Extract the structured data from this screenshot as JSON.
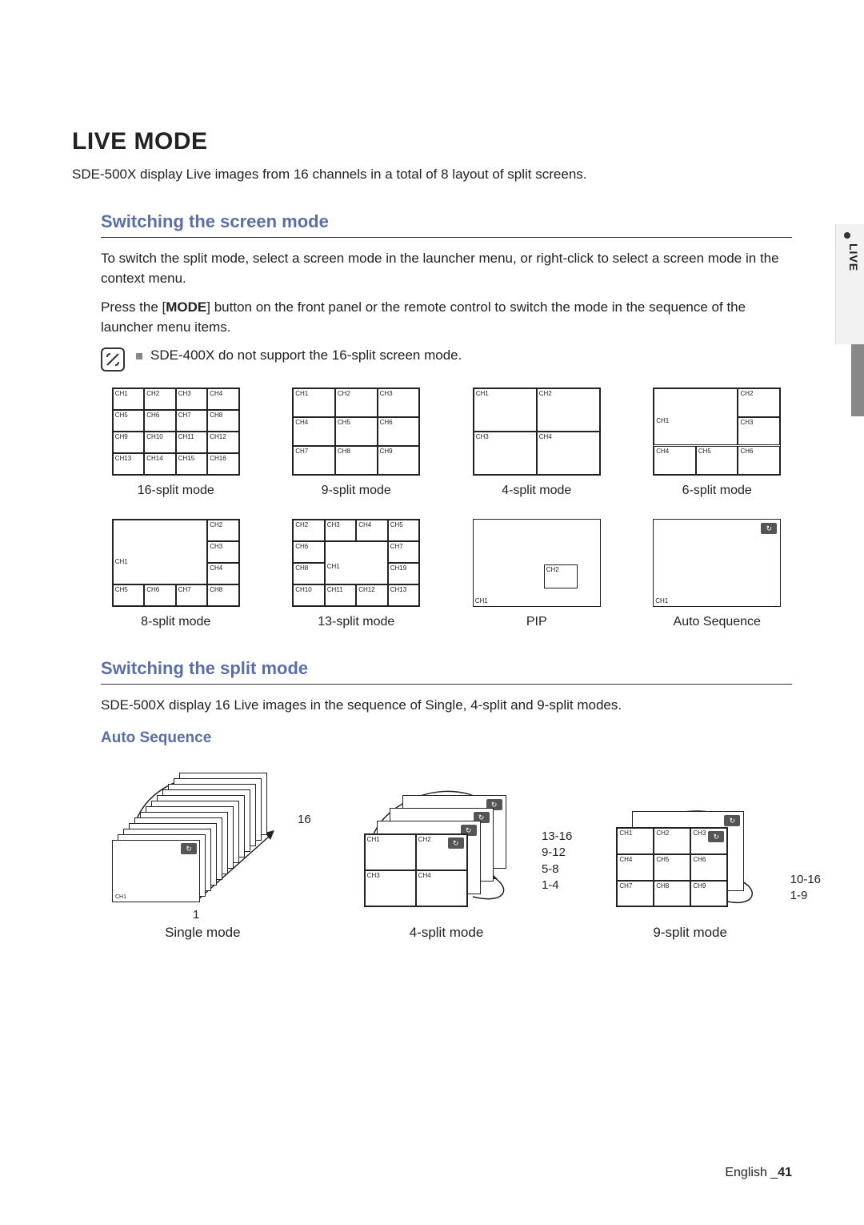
{
  "sideTab": "LIVE",
  "heading": "LIVE MODE",
  "intro": "SDE-500X display Live images from 16 channels in a total of 8 layout of split screens.",
  "section1": {
    "title": "Switching the screen mode",
    "para1": "To switch the split mode, select a screen mode in the launcher menu, or right-click to select a screen mode in the context menu.",
    "para2a": "Press the [",
    "para2bold": "MODE",
    "para2b": "] button on the front panel or the remote control to switch the mode in the sequence of the launcher menu items.",
    "note": "SDE-400X do not support the 16-split screen mode."
  },
  "diagRow1": {
    "d16": {
      "label": "16-split mode",
      "cells": [
        "CH1",
        "CH2",
        "CH3",
        "CH4",
        "CH5",
        "CH6",
        "CH7",
        "CH8",
        "CH9",
        "CH10",
        "CH11",
        "CH12",
        "CH13",
        "CH14",
        "CH15",
        "CH16"
      ]
    },
    "d9": {
      "label": "9-split mode",
      "cells": [
        "CH1",
        "CH2",
        "CH3",
        "CH4",
        "CH5",
        "CH6",
        "CH7",
        "CH8",
        "CH9"
      ]
    },
    "d4": {
      "label": "4-split mode",
      "cells": [
        "CH1",
        "CH2",
        "CH3",
        "CH4"
      ]
    },
    "d6": {
      "label": "6-split mode",
      "big": "CH1",
      "right": [
        "CH2",
        "CH3"
      ],
      "bottom": [
        "CH4",
        "CH5",
        "CH6"
      ]
    }
  },
  "diagRow2": {
    "d8": {
      "label": "8-split mode",
      "big": "CH1",
      "right": [
        "CH2",
        "CH3",
        "CH4"
      ],
      "bottom": [
        "CH5",
        "CH6",
        "CH7",
        "CH8"
      ]
    },
    "d13": {
      "label": "13-split mode",
      "top": [
        "CH2",
        "CH3",
        "CH4",
        "CH5"
      ],
      "leftMid": [
        "CH6",
        "CH8"
      ],
      "big": "CH1",
      "rightMid": [
        "CH7",
        "CH19"
      ],
      "bottom": [
        "CH10",
        "CH11",
        "CH12",
        "CH13"
      ]
    },
    "pip": {
      "label": "PIP",
      "big": "CH1",
      "small": "CH2"
    },
    "auto": {
      "label": "Auto Sequence",
      "big": "CH1"
    }
  },
  "section2": {
    "title": "Switching the split mode",
    "para": "SDE-500X display 16 Live images in the sequence of Single, 4-split and 9-split modes."
  },
  "section3": {
    "title": "Auto Sequence"
  },
  "seq": {
    "single": {
      "label": "Single mode",
      "frontCh": "CH1",
      "num1": "1",
      "num16": "16"
    },
    "four": {
      "label": "4-split mode",
      "cells": [
        "CH1",
        "CH2",
        "CH3",
        "CH4"
      ],
      "ranges": [
        "13-16",
        "9-12",
        "5-8",
        "1-4"
      ]
    },
    "nine": {
      "label": "9-split mode",
      "cells": [
        "CH1",
        "CH2",
        "CH3",
        "CH4",
        "CH5",
        "CH6",
        "CH7",
        "CH8",
        "CH9"
      ],
      "ranges": [
        "10-16",
        "1-9"
      ]
    }
  },
  "footer": {
    "lang": "English",
    "sep": "_",
    "page": "41"
  }
}
